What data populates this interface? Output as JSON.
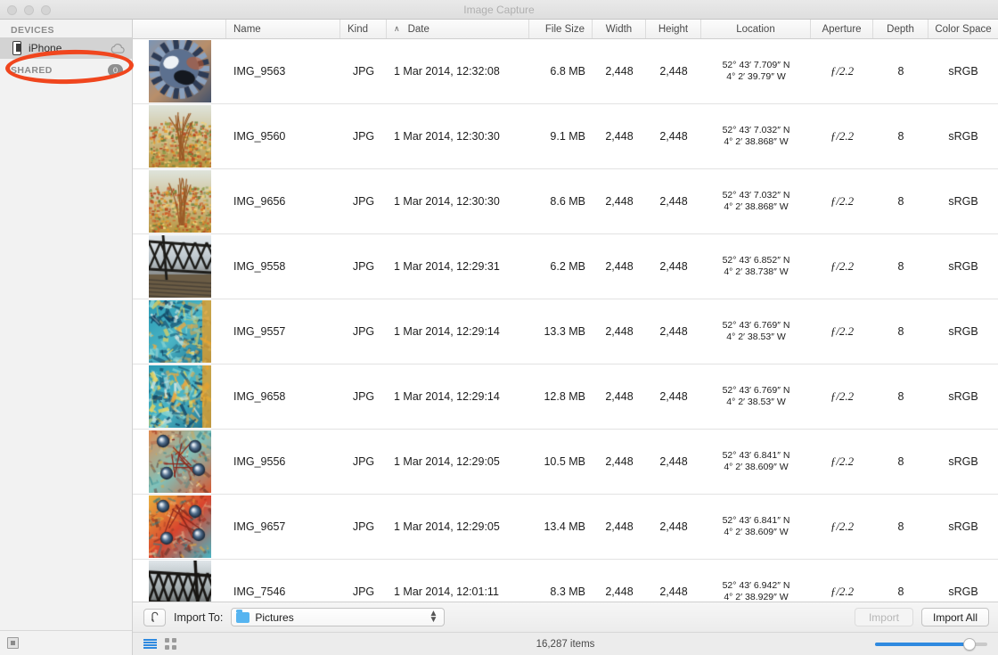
{
  "window": {
    "title": "Image Capture"
  },
  "sidebar": {
    "devices_header": "DEVICES",
    "shared_header": "SHARED",
    "shared_badge": "0",
    "devices": [
      {
        "label": "iPhone",
        "icon": "iphone-icon",
        "accessory": "cloud-icon"
      }
    ],
    "annotation_color": "#f0461e"
  },
  "table": {
    "columns": [
      {
        "key": "thumb",
        "label": ""
      },
      {
        "key": "name",
        "label": "Name"
      },
      {
        "key": "kind",
        "label": "Kind"
      },
      {
        "key": "date",
        "label": "Date",
        "sorted": true,
        "sort_caret": "∧"
      },
      {
        "key": "size",
        "label": "File Size"
      },
      {
        "key": "width",
        "label": "Width"
      },
      {
        "key": "height",
        "label": "Height"
      },
      {
        "key": "loc",
        "label": "Location"
      },
      {
        "key": "aper",
        "label": "Aperture"
      },
      {
        "key": "depth",
        "label": "Depth"
      },
      {
        "key": "cs",
        "label": "Color Space"
      }
    ],
    "rows": [
      {
        "name": "IMG_9563",
        "kind": "JPG",
        "date": "1 Mar 2014, 12:32:08",
        "size": "6.8 MB",
        "width": "2,448",
        "height": "2,448",
        "lat": "52° 43′ 7.709″ N",
        "lon": "4° 2′ 39.79″ W",
        "aperture": "ƒ/2.2",
        "depth": "8",
        "color_space": "sRGB",
        "thumb": "gear"
      },
      {
        "name": "IMG_9560",
        "kind": "JPG",
        "date": "1 Mar 2014, 12:30:30",
        "size": "9.1 MB",
        "width": "2,448",
        "height": "2,448",
        "lat": "52° 43′ 7.032″ N",
        "lon": "4° 2′ 38.868″ W",
        "aperture": "ƒ/2.2",
        "depth": "8",
        "color_space": "sRGB",
        "thumb": "autumn"
      },
      {
        "name": "IMG_9656",
        "kind": "JPG",
        "date": "1 Mar 2014, 12:30:30",
        "size": "8.6 MB",
        "width": "2,448",
        "height": "2,448",
        "lat": "52° 43′ 7.032″ N",
        "lon": "4° 2′ 38.868″ W",
        "aperture": "ƒ/2.2",
        "depth": "8",
        "color_space": "sRGB",
        "thumb": "autumn"
      },
      {
        "name": "IMG_9558",
        "kind": "JPG",
        "date": "1 Mar 2014, 12:29:31",
        "size": "6.2 MB",
        "width": "2,448",
        "height": "2,448",
        "lat": "52° 43′ 6.852″ N",
        "lon": "4° 2′ 38.738″ W",
        "aperture": "ƒ/2.2",
        "depth": "8",
        "color_space": "sRGB",
        "thumb": "bridge"
      },
      {
        "name": "IMG_9557",
        "kind": "JPG",
        "date": "1 Mar 2014, 12:29:14",
        "size": "13.3 MB",
        "width": "2,448",
        "height": "2,448",
        "lat": "52° 43′ 6.769″ N",
        "lon": "4° 2′ 38.53″ W",
        "aperture": "ƒ/2.2",
        "depth": "8",
        "color_space": "sRGB",
        "thumb": "teal"
      },
      {
        "name": "IMG_9658",
        "kind": "JPG",
        "date": "1 Mar 2014, 12:29:14",
        "size": "12.8 MB",
        "width": "2,448",
        "height": "2,448",
        "lat": "52° 43′ 6.769″ N",
        "lon": "4° 2′ 38.53″ W",
        "aperture": "ƒ/2.2",
        "depth": "8",
        "color_space": "sRGB",
        "thumb": "teal"
      },
      {
        "name": "IMG_9556",
        "kind": "JPG",
        "date": "1 Mar 2014, 12:29:05",
        "size": "10.5 MB",
        "width": "2,448",
        "height": "2,448",
        "lat": "52° 43′ 6.841″ N",
        "lon": "4° 2′ 38.609″ W",
        "aperture": "ƒ/2.2",
        "depth": "8",
        "color_space": "sRGB",
        "thumb": "rivets"
      },
      {
        "name": "IMG_9657",
        "kind": "JPG",
        "date": "1 Mar 2014, 12:29:05",
        "size": "13.4 MB",
        "width": "2,448",
        "height": "2,448",
        "lat": "52° 43′ 6.841″ N",
        "lon": "4° 2′ 38.609″ W",
        "aperture": "ƒ/2.2",
        "depth": "8",
        "color_space": "sRGB",
        "thumb": "rivets2"
      },
      {
        "name": "IMG_7546",
        "kind": "JPG",
        "date": "1 Mar 2014, 12:01:11",
        "size": "8.3 MB",
        "width": "2,448",
        "height": "2,448",
        "lat": "52° 43′ 6.942″ N",
        "lon": "4° 2′ 38.929″ W",
        "aperture": "ƒ/2.2",
        "depth": "8",
        "color_space": "sRGB",
        "thumb": "truss"
      }
    ]
  },
  "import_bar": {
    "rotate_icon": "rotate-left-icon",
    "import_to_label": "Import To:",
    "destination": "Pictures",
    "destination_icon": "folder-icon",
    "import_button": "Import",
    "import_all_button": "Import All"
  },
  "status_bar": {
    "list_view_icon": "list-view-icon",
    "grid_view_icon": "grid-view-icon",
    "items_count": "16,287 items",
    "zoom_value": 84,
    "accent_color": "#2f8ae0"
  }
}
